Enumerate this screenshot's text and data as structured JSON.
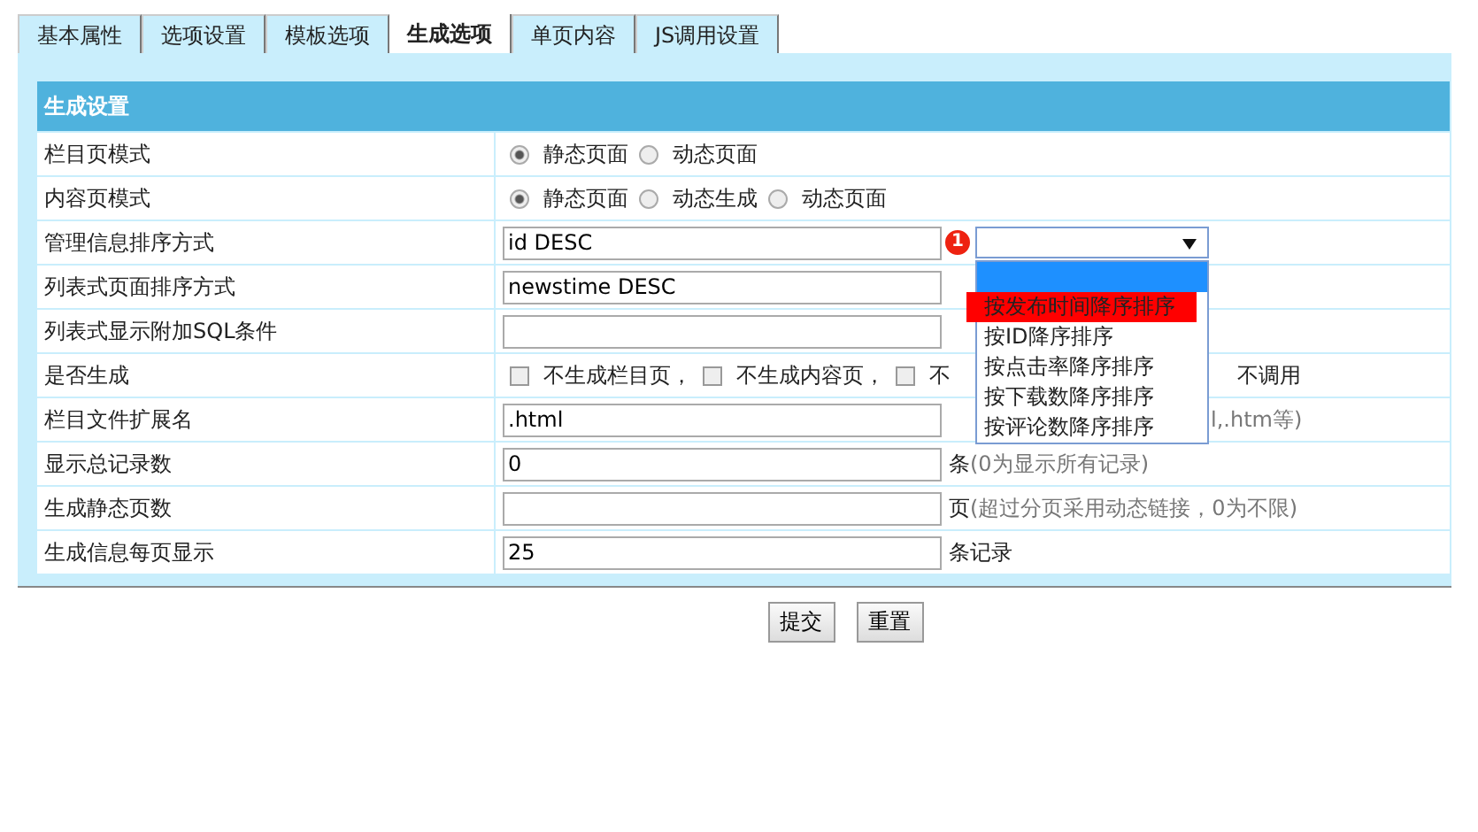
{
  "tabs": [
    {
      "label": "基本属性",
      "selected": false
    },
    {
      "label": "选项设置",
      "selected": false
    },
    {
      "label": "模板选项",
      "selected": false
    },
    {
      "label": "生成选项",
      "selected": true
    },
    {
      "label": "单页内容",
      "selected": false
    },
    {
      "label": "JS调用设置",
      "selected": false
    }
  ],
  "panel": {
    "title": "生成设置",
    "rows": [
      {
        "label": "栏目页模式",
        "kind": "radio",
        "options": [
          {
            "label": "静态页面",
            "selected": true
          },
          {
            "label": "动态页面",
            "selected": false
          }
        ]
      },
      {
        "label": "内容页模式",
        "kind": "radio",
        "options": [
          {
            "label": "静态页面",
            "selected": true
          },
          {
            "label": "动态生成",
            "selected": false
          },
          {
            "label": "动态页面",
            "selected": false
          }
        ]
      },
      {
        "label": "管理信息排序方式",
        "kind": "input",
        "value": "id DESC",
        "badge": "1",
        "dropdown": {
          "options": [
            {
              "selected": true,
              "marked": false
            },
            {
              "label": "按发布时间降序排序",
              "selected": false,
              "marked": true
            },
            {
              "label": "按ID降序排序",
              "selected": false,
              "marked": false
            },
            {
              "label": "按点击率降序排序",
              "selected": false,
              "marked": false
            },
            {
              "label": "按下载数降序排序",
              "selected": false,
              "marked": false
            },
            {
              "label": "按评论数降序排序",
              "selected": false,
              "marked": false
            }
          ]
        }
      },
      {
        "label": "列表式页面排序方式",
        "kind": "input",
        "value": "newstime DESC"
      },
      {
        "label": "列表式显示附加SQL条件",
        "kind": "input",
        "value": ""
      },
      {
        "label": "是否生成",
        "kind": "checkbox",
        "options": [
          {
            "label": "不生成栏目页，",
            "checked": false
          },
          {
            "label": "不生成内容页，",
            "checked": false
          },
          {
            "label": "不",
            "checked": false
          }
        ],
        "tail": "不调用"
      },
      {
        "label": "栏目文件扩展名",
        "kind": "input",
        "value": ".html",
        "hint": "l,.htm等)"
      },
      {
        "label": "显示总记录数",
        "kind": "input",
        "value": "0",
        "unit": "条",
        "hint": "(0为显示所有记录)"
      },
      {
        "label": "生成静态页数",
        "kind": "input",
        "value": "",
        "unit": "页",
        "hint": "(超过分页采用动态链接，0为不限)"
      },
      {
        "label": "生成信息每页显示",
        "kind": "input",
        "value": "25",
        "unit": "条记录"
      }
    ]
  },
  "buttons": [
    "提交",
    "重置"
  ]
}
